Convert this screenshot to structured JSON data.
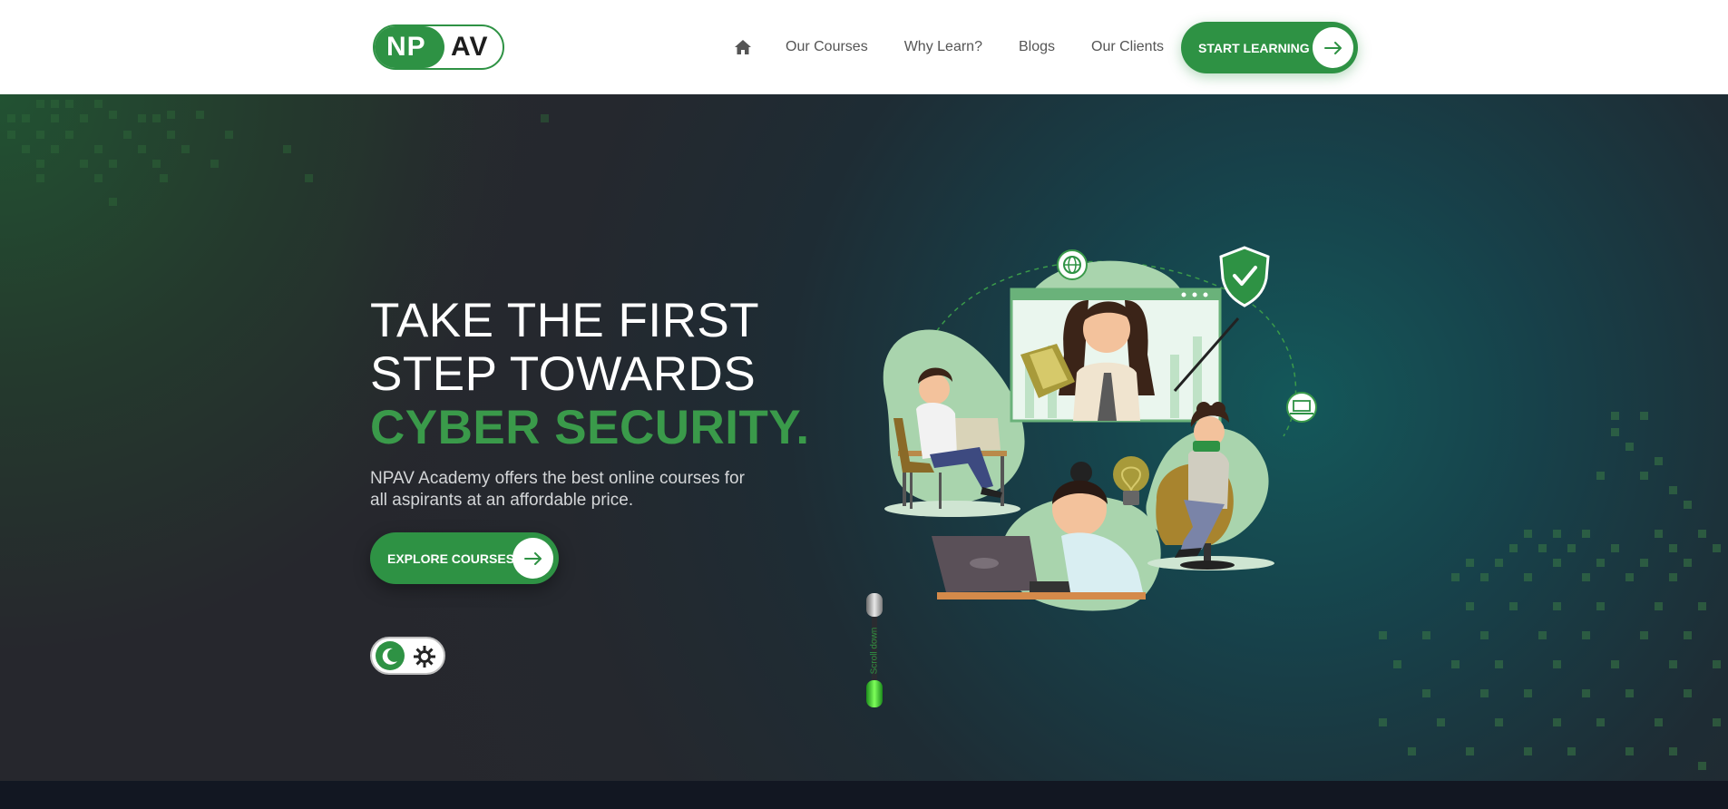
{
  "brand": {
    "logo_left": "NP",
    "logo_right": "AV",
    "accent": "#2e9244"
  },
  "nav": {
    "home_icon": "home-icon",
    "items": [
      "Our Courses",
      "Why Learn?",
      "Blogs",
      "Our Clients"
    ],
    "cta_label": "START LEARNING",
    "cta_icon": "arrow-right-icon"
  },
  "hero": {
    "headline_line1": "TAKE THE FIRST",
    "headline_line2": "STEP TOWARDS",
    "headline_accent": "CYBER SECURITY.",
    "subtitle": "NPAV Academy offers the best online courses for all aspirants at an affordable price.",
    "button_label": "EXPLORE COURSES",
    "button_icon": "arrow-right-icon",
    "theme_toggle": {
      "dark_icon": "moon-icon",
      "light_icon": "sun-icon"
    },
    "scroll_label": "Scroll down",
    "illustration": "online-learning-illustration"
  },
  "colors": {
    "header_bg": "#ffffff",
    "hero_bg": "#26272d",
    "teal_glow": "#14585a",
    "accent_green": "#3a9a4a"
  }
}
